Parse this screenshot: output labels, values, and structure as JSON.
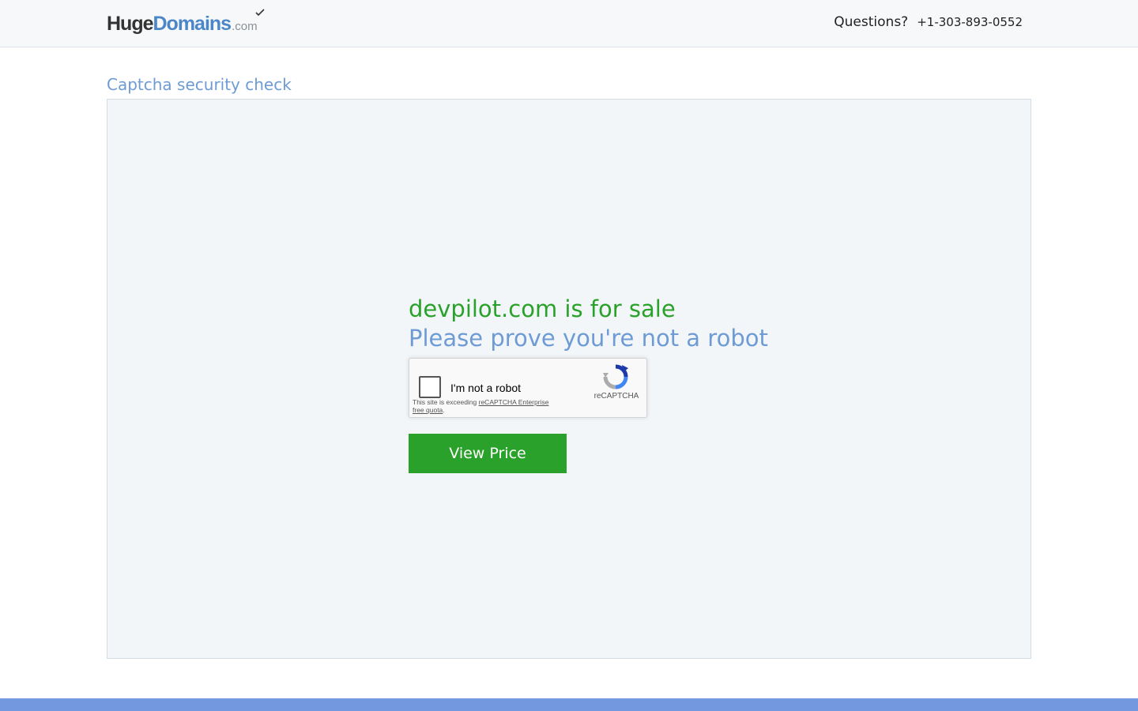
{
  "header": {
    "logo": {
      "part1": "Huge",
      "part2": "Domains",
      "part3": ".com"
    },
    "questions_label": "Questions?",
    "phone": "+1-303-893-0552"
  },
  "main": {
    "section_title": "Captcha security check",
    "sale_heading": "devpilot.com is for sale",
    "prove_heading": "Please prove you're not a robot",
    "captcha": {
      "checkbox_label": "I'm not a robot",
      "quota_prefix": "This site is exceeding ",
      "quota_link": "reCAPTCHA Enterprise free quota",
      "quota_suffix": ".",
      "brand": "reCAPTCHA"
    },
    "view_price_button": "View Price"
  },
  "colors": {
    "accent_green": "#2aa12a",
    "accent_blue": "#6e9bd4",
    "footer_bar": "#7398e0"
  }
}
